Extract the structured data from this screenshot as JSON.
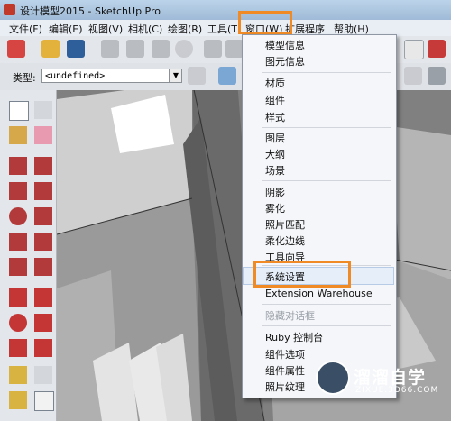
{
  "window": {
    "title": "设计模型2015 - SketchUp Pro"
  },
  "menubar": {
    "items": [
      "文件(F)",
      "编辑(E)",
      "视图(V)",
      "相机(C)",
      "绘图(R)",
      "工具(T)",
      "窗口(W)",
      "扩展程序",
      "帮助(H)"
    ]
  },
  "entity_info": {
    "type_label": "类型:",
    "type_value": "<undefined>"
  },
  "window_menu": {
    "groups": [
      [
        "模型信息",
        "图元信息"
      ],
      [
        "材质",
        "组件",
        "样式"
      ],
      [
        "图层",
        "大纲",
        "场景"
      ],
      [
        "阴影",
        "雾化",
        "照片匹配",
        "柔化边线",
        "工具向导"
      ],
      [
        "系统设置",
        "Extension Warehouse"
      ],
      [
        "隐藏对话框"
      ],
      [
        "Ruby 控制台",
        "组件选项",
        "组件属性",
        "照片纹理"
      ]
    ],
    "disabled": [
      "隐藏对话框"
    ],
    "highlighted": "系统设置"
  },
  "watermark": {
    "name": "溜溜自学",
    "url": "ZIXUE.3D66.COM"
  },
  "colors": {
    "highlight_box": "#f08a24",
    "menu_bg": "#f4f6f9",
    "titlebar": "#bcd4ea"
  }
}
